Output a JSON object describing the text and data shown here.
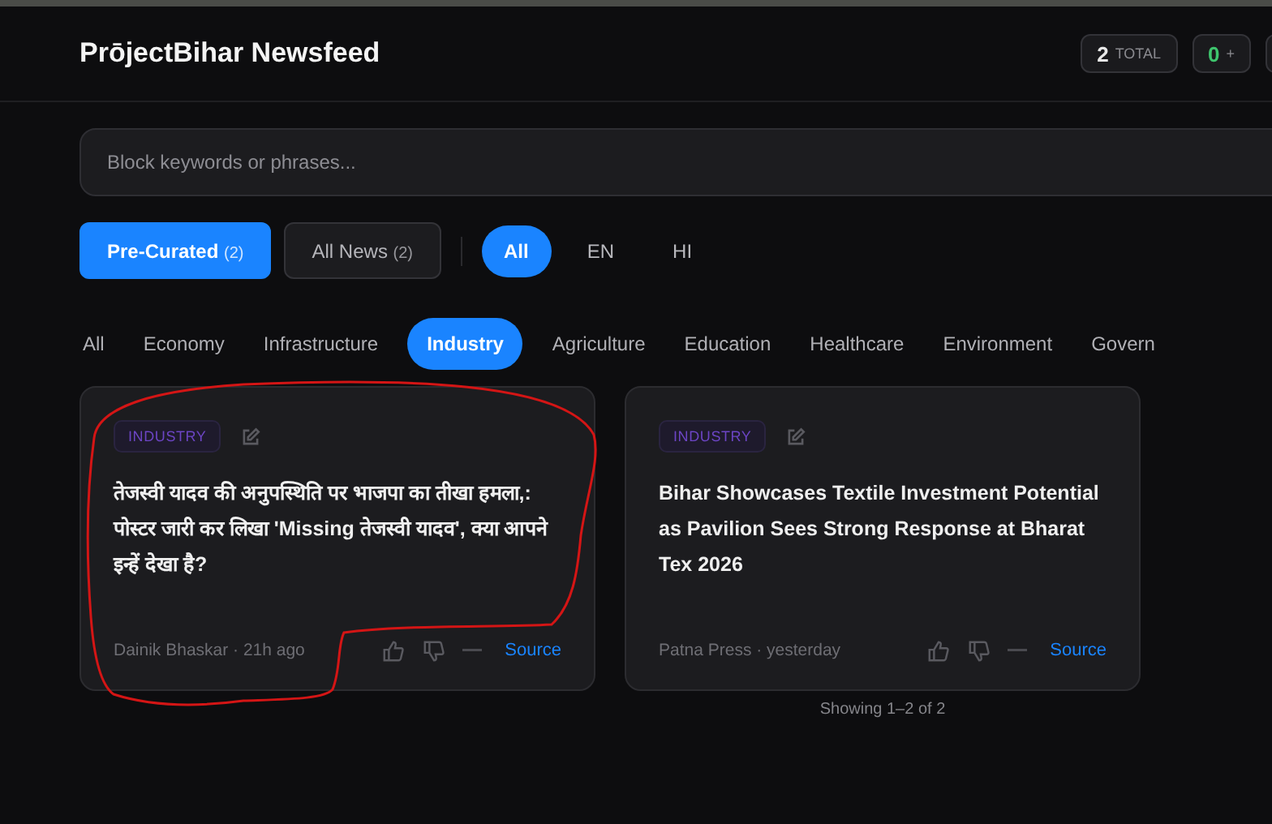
{
  "header": {
    "title": "PrōjectBihar Newsfeed",
    "stats": [
      {
        "value": "2",
        "label": "TOTAL",
        "kind": "total"
      },
      {
        "value": "0",
        "label": "+",
        "kind": "positive"
      }
    ]
  },
  "search": {
    "placeholder": "Block keywords or phrases..."
  },
  "feeds": [
    {
      "label": "Pre-Curated",
      "count": "(2)",
      "selected": true
    },
    {
      "label": "All News",
      "count": "(2)",
      "selected": false
    }
  ],
  "languages": [
    {
      "label": "All",
      "selected": true
    },
    {
      "label": "EN",
      "selected": false
    },
    {
      "label": "HI",
      "selected": false
    }
  ],
  "categories": [
    {
      "label": "All",
      "selected": false
    },
    {
      "label": "Economy",
      "selected": false
    },
    {
      "label": "Infrastructure",
      "selected": false
    },
    {
      "label": "Industry",
      "selected": true
    },
    {
      "label": "Agriculture",
      "selected": false
    },
    {
      "label": "Education",
      "selected": false
    },
    {
      "label": "Healthcare",
      "selected": false
    },
    {
      "label": "Environment",
      "selected": false
    },
    {
      "label": "Govern",
      "selected": false
    }
  ],
  "articles": [
    {
      "tag": "INDUSTRY",
      "title": "तेजस्वी यादव की अनुपस्थिति पर भाजपा का तीखा हमला,: पोस्टर जारी कर लिखा 'Missing तेजस्वी यादव', क्या आपने इन्हें देखा है?",
      "meta": "Dainik Bhaskar · 21h ago",
      "link": "Source"
    },
    {
      "tag": "INDUSTRY",
      "title": "Bihar Showcases Textile Investment Potential as Pavilion Sees Strong Response at Bharat Tex 2026",
      "meta": "Patna Press · yesterday",
      "link": "Source"
    }
  ],
  "footer": "Showing 1–2 of 2"
}
